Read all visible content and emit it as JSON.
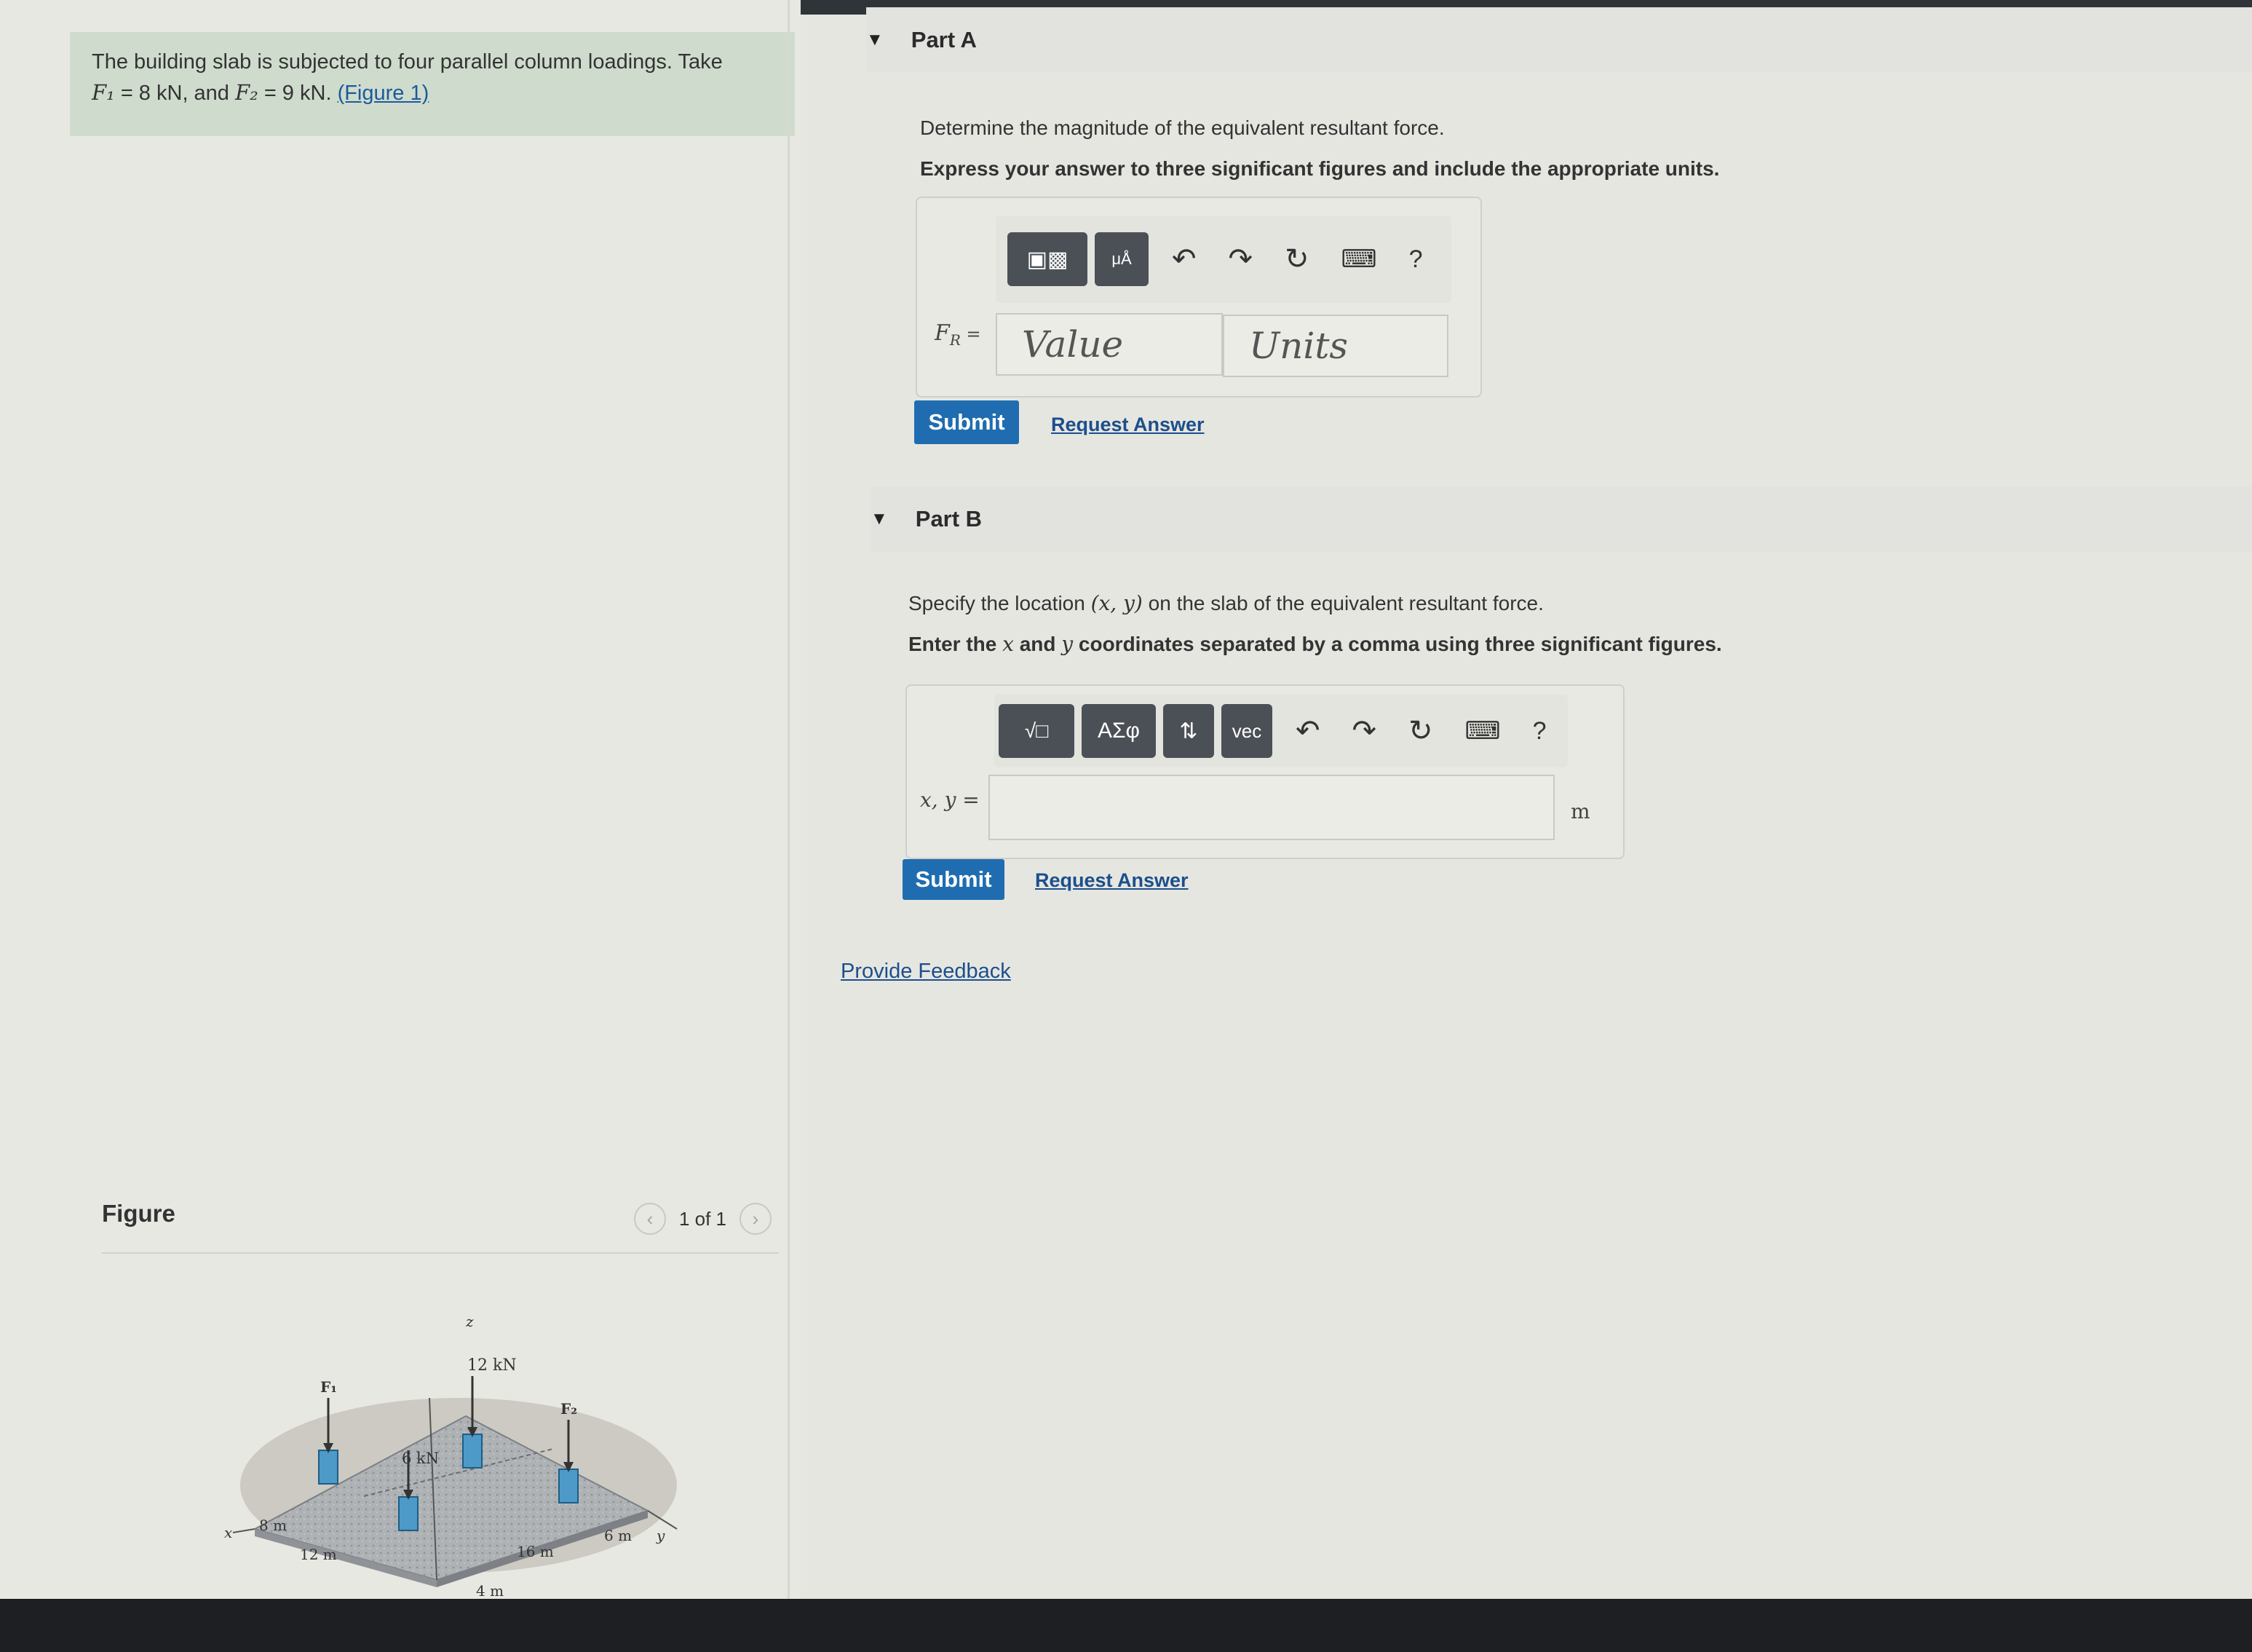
{
  "problem": {
    "text_start": "The building slab is subjected to four parallel column loadings. Take",
    "f1_label": "F₁",
    "f1_value": "= 8 kN",
    "sep": ", and",
    "f2_label": "F₂",
    "f2_value": "= 9 kN",
    "sep2": ".",
    "figure_link": "(Figure 1)"
  },
  "figure": {
    "title": "Figure",
    "page_count": "1 of 1",
    "prev_icon": "‹",
    "next_icon": "›",
    "labels": {
      "z": "z",
      "x": "x",
      "y": "y",
      "f1": "F₁",
      "f2": "F₂",
      "load_12": "12 kN",
      "load_6": "6 kN",
      "d_8": "8 m",
      "d_12": "12 m",
      "d_4": "4 m",
      "d_16": "16 m",
      "d_6": "6 m"
    }
  },
  "partA": {
    "title": "Part A",
    "prompt": "Determine the magnitude of the equivalent resultant force.",
    "instruction": "Express your answer to three significant figures and include the appropriate units.",
    "field_label": "F",
    "field_label_sub": "R",
    "field_label_eq": " =",
    "value_placeholder": "Value",
    "units_placeholder": "Units",
    "submit": "Submit",
    "request": "Request Answer",
    "tb_units": "μÅ",
    "help": "?"
  },
  "partB": {
    "title": "Part B",
    "prompt_a": "Specify the location",
    "prompt_math": "(x, y)",
    "prompt_b": "on the slab of the equivalent resultant force.",
    "instr_a": "Enter the",
    "instr_x": "x",
    "instr_and": "and",
    "instr_y": "y",
    "instr_b": "coordinates separated by a comma using three significant figures.",
    "field_label": "x, y =",
    "unit": "m",
    "tb_sqrt": "√□",
    "tb_greek": "ΑΣφ",
    "tb_arrows": "⇅",
    "tb_vec": "vec",
    "submit": "Submit",
    "request": "Request Answer",
    "help": "?"
  },
  "feedback": "Provide Feedback"
}
